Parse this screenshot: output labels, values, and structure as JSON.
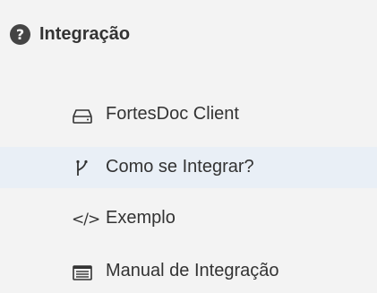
{
  "menu": {
    "section": {
      "title": "Integração",
      "icon": "help-circle-icon",
      "icon_glyph": "?"
    },
    "items": [
      {
        "label": "FortesDoc Client",
        "icon": "drive-icon",
        "active": false
      },
      {
        "label": "Como se Integrar?",
        "icon": "fork-icon",
        "active": true
      },
      {
        "label": "Exemplo",
        "icon": "code-icon",
        "icon_glyph": "</>",
        "active": false
      },
      {
        "label": "Manual de Integração",
        "icon": "list-icon",
        "active": false
      }
    ]
  },
  "colors": {
    "menu_background": "#f3f3f3",
    "active_background": "#e9eff6",
    "text": "#333333"
  }
}
